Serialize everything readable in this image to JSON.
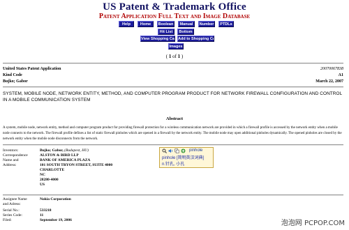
{
  "header": {
    "title": "US Patent & Trademark Office",
    "subtitle": "Patent Application Full Text and Image Database"
  },
  "nav": {
    "row1": [
      "Help",
      "Home",
      "Boolean",
      "Manual",
      "Number",
      "PTDLs"
    ],
    "row2": [
      "Hit List",
      "Bottom"
    ],
    "row3": [
      "View Shopping Cart",
      "Add to Shopping Cart"
    ],
    "row4": [
      "Images"
    ]
  },
  "pager": {
    "open": "( ",
    "current": "1",
    "of": " of ",
    "total": "1",
    "close": " )"
  },
  "doc": {
    "kind_label": "United States Patent Application",
    "number": "20070067838",
    "kind_code_label": "Kind Code",
    "kind_code": "A1",
    "inventor_short": "Bujko; Gabor",
    "date": "March 22, 2007",
    "title": "SYSTEM, MOBILE NODE, NETWORK ENTITY, METHOD, AND COMPUTER PROGRAM PRODUCT FOR NETWORK FIREWALL CONFIGURATION AND CONTROL IN A MOBILE COMMUNICATION SYSTEM"
  },
  "abstract": {
    "heading": "Abstract",
    "text": "A system, mobile node, network entity, method and computer program product for providing firewall protection for a wireless communication network are provided in which a firewall profile is accessed by the network entity when a mobile node connects to the network. The firewall profile defines a list of static firewall pinholes which are opened in a firewall by the network entity. The mobile node may open additional pinholes dynamically. The opened pinholes are closed by the network entity when the mobile node disconnects from the network."
  },
  "meta": {
    "inventors_label": "Inventors:",
    "inventors_name": "Bujko; Gabor,",
    "inventors_loc": " (Budapest, HU)",
    "corr_label": [
      "Correspondence",
      "Name and",
      "Address:"
    ],
    "corr_value": [
      "ALSTON & BIRD LLP",
      "BANK OF AMERICA PLAZA",
      "101 SOUTH TRYON STREET, SUITE 4000",
      "CHARLOTTE",
      "NC",
      "28280-4000",
      "US"
    ],
    "assignee_label": [
      "Assignee Name",
      "and Adress:"
    ],
    "assignee_value": "Nokia Corporation",
    "serial_label": "Serial No.:",
    "serial_value": "533218",
    "series_label": "Series Code:",
    "series_value": "11",
    "filed_label": "Filed:",
    "filed_value": "September 19, 2006"
  },
  "tooltip": {
    "word": "pinhole",
    "line2": "pinhole [简明英汉词典]",
    "line3": "n.针孔, 小孔"
  },
  "watermark": "泡泡网 PCPOP.COM"
}
